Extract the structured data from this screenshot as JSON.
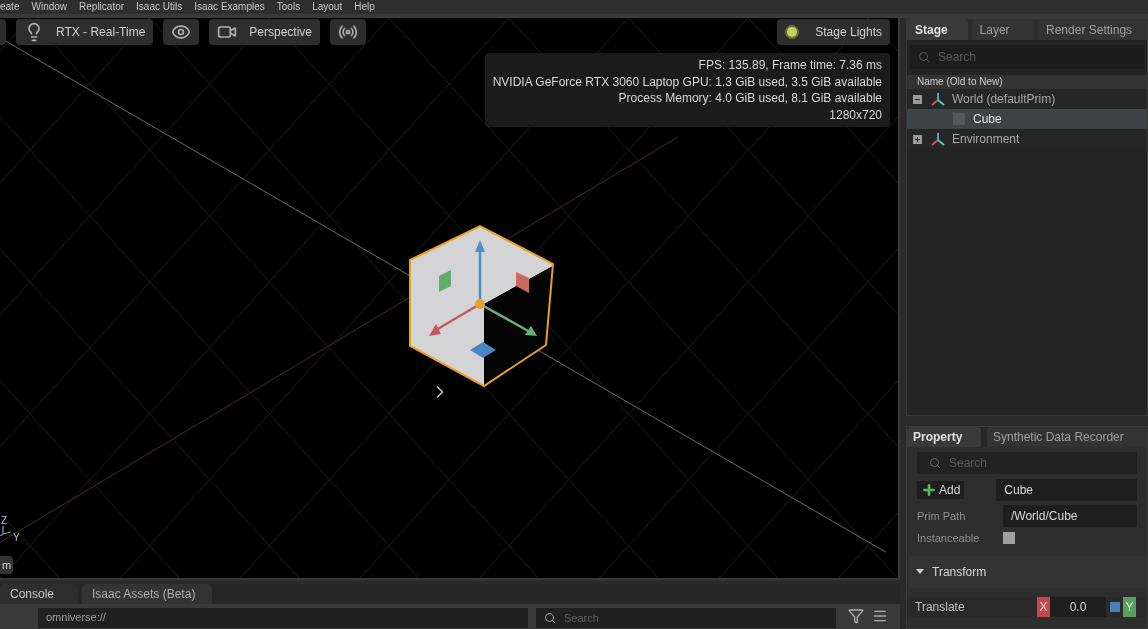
{
  "menu": [
    "eate",
    "Window",
    "Replicator",
    "Isaac Utils",
    "Isaac Examples",
    "Tools",
    "Layout",
    "Help"
  ],
  "viewport": {
    "toolbar": [
      {
        "kind": "render",
        "label": "RTX - Real-Time"
      },
      {
        "kind": "eye"
      },
      {
        "kind": "camera",
        "label": "Perspective"
      },
      {
        "kind": "audio"
      }
    ],
    "stage_lights": "Stage Lights",
    "stats": [
      "FPS: 135.89, Frame time: 7.36 ms",
      "NVIDIA GeForce RTX 3060 Laptop GPU: 1.3 GiB used, 3.5 GiB available",
      "Process Memory: 4.0 GiB used, 8.1 GiB available",
      "1280x720"
    ],
    "axis_labels": [
      "Z",
      "Y"
    ],
    "corner_button": "m"
  },
  "bottom_tabs": [
    {
      "label": "Console",
      "selected": true
    },
    {
      "label": "Isaac Assets (Beta)",
      "selected": false
    }
  ],
  "path_bar": {
    "value": "omniverse://",
    "search_placeholder": "Search"
  },
  "stage_panel": {
    "tabs": [
      {
        "label": "Stage",
        "selected": true
      },
      {
        "label": "Layer",
        "selected": false
      },
      {
        "label": "Render Settings",
        "selected": false
      }
    ],
    "search_placeholder": "Search",
    "column": "Name (Old to New)",
    "tree": [
      {
        "label": "World (defaultPrim)",
        "kind": "xform",
        "expanded": true,
        "selected": false,
        "children": [
          {
            "label": "Cube",
            "kind": "mesh",
            "selected": true
          }
        ]
      },
      {
        "label": "Environment",
        "kind": "xform",
        "expanded": false,
        "selected": false
      }
    ]
  },
  "property_panel": {
    "tabs": [
      {
        "label": "Property",
        "selected": true
      },
      {
        "label": "Synthetic Data Recorder",
        "selected": false
      }
    ],
    "search_placeholder": "Search",
    "add_label": "Add",
    "name_value": "Cube",
    "fields": [
      {
        "label": "Prim Path",
        "value": "/World/Cube"
      }
    ],
    "instanceable": {
      "label": "Instanceable",
      "checked": false
    },
    "section": {
      "label": "Transform",
      "expanded": true
    },
    "translate": {
      "label": "Translate",
      "x_label": "X",
      "x_value": "0.0",
      "y_label": "Y"
    }
  }
}
